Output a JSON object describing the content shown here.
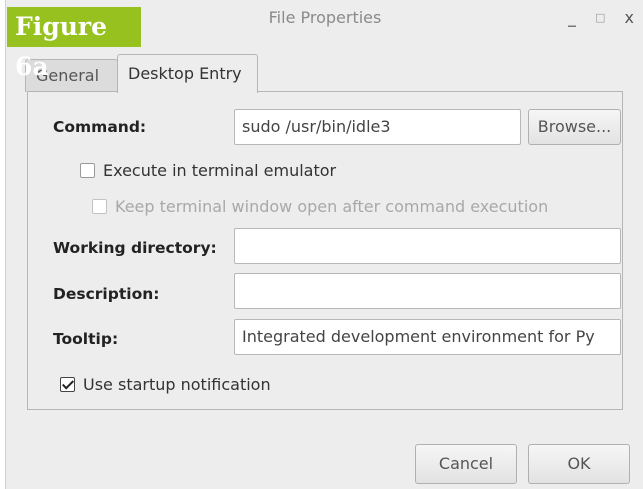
{
  "figure_label": "Figure 6a",
  "window": {
    "title": "File Properties",
    "minimize_glyph": "_",
    "maximize_glyph": "□",
    "close_glyph": "x"
  },
  "tabs": [
    {
      "label": "General",
      "active": false
    },
    {
      "label": "Desktop Entry",
      "active": true
    }
  ],
  "form": {
    "command_label": "Command:",
    "command_value": "sudo /usr/bin/idle3",
    "browse_label": "Browse...",
    "execute_in_terminal_label": "Execute in terminal emulator",
    "execute_in_terminal_checked": false,
    "keep_terminal_open_label": "Keep terminal window open after command execution",
    "keep_terminal_open_checked": false,
    "keep_terminal_open_enabled": false,
    "working_directory_label": "Working directory:",
    "working_directory_value": "",
    "description_label": "Description:",
    "description_value": "",
    "tooltip_label": "Tooltip:",
    "tooltip_value": "Integrated development environment for Py",
    "startup_notification_label": "Use startup notification",
    "startup_notification_checked": true
  },
  "footer": {
    "cancel_label": "Cancel",
    "ok_label": "OK"
  }
}
